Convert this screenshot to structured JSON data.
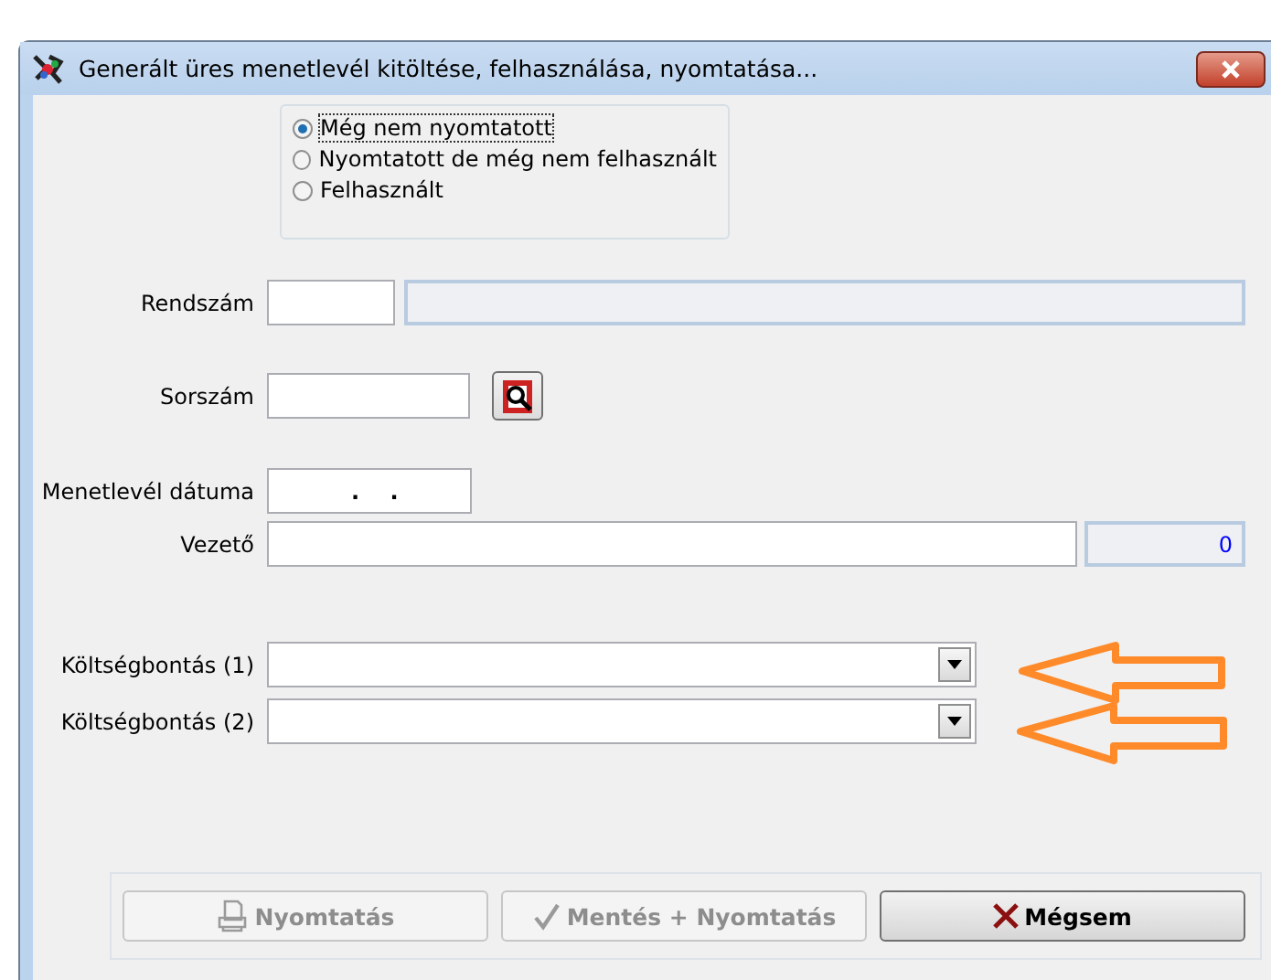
{
  "window": {
    "title": "Generált üres menetlevél kitöltése, felhasználása, nyomtatása..."
  },
  "status": {
    "options": [
      {
        "label": "Még nem nyomtatott",
        "selected": true
      },
      {
        "label": "Nyomtatott de még nem felhasznált",
        "selected": false
      },
      {
        "label": "Felhasznált",
        "selected": false
      }
    ]
  },
  "rendszam": {
    "label": "Rendszám"
  },
  "sorszam": {
    "label": "Sorszám"
  },
  "datum": {
    "label": "Menetlevél dátuma",
    "value": ".    ."
  },
  "vezeto": {
    "label": "Vezető",
    "number": "0"
  },
  "koltseg": [
    {
      "label": "Költségbontás (1)"
    },
    {
      "label": "Költségbontás (2)"
    }
  ],
  "buttons": [
    {
      "kind": "print",
      "label": "Nyomtatás",
      "disabled": true
    },
    {
      "kind": "save",
      "label": "Mentés + Nyomtatás",
      "disabled": true
    },
    {
      "kind": "cancel",
      "label": "Mégsem",
      "disabled": false
    }
  ]
}
